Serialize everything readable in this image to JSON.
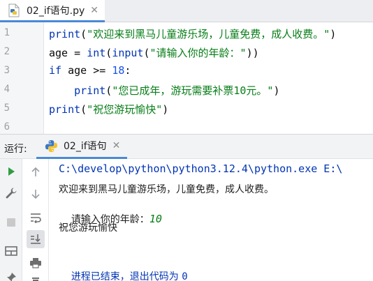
{
  "editor_tab": {
    "title": "02_if语句.py",
    "close": "✕",
    "icon": "python-file-icon"
  },
  "code_lines": [
    {
      "num": "1",
      "parts": [
        {
          "t": "print",
          "c": "kw-fn"
        },
        {
          "t": "(",
          "c": ""
        },
        {
          "t": "\"欢迎来到黑马儿童游乐场，儿童免费，成人收费。\"",
          "c": "str"
        },
        {
          "t": ")",
          "c": ""
        }
      ]
    },
    {
      "num": "2",
      "parts": [
        {
          "t": "age = ",
          "c": ""
        },
        {
          "t": "int",
          "c": "kw-fn"
        },
        {
          "t": "(",
          "c": ""
        },
        {
          "t": "input",
          "c": "kw-fn"
        },
        {
          "t": "(",
          "c": ""
        },
        {
          "t": "\"请输入你的年龄：\"",
          "c": "str"
        },
        {
          "t": "))",
          "c": ""
        }
      ]
    },
    {
      "num": "3",
      "parts": [
        {
          "t": "if",
          "c": "kw-fn"
        },
        {
          "t": " age >= ",
          "c": ""
        },
        {
          "t": "18",
          "c": "num"
        },
        {
          "t": ":",
          "c": ""
        }
      ]
    },
    {
      "num": "4",
      "parts": [
        {
          "t": "    ",
          "c": ""
        },
        {
          "t": "print",
          "c": "kw-fn"
        },
        {
          "t": "(",
          "c": ""
        },
        {
          "t": "\"您已成年，游玩需要补票10元。\"",
          "c": "str"
        },
        {
          "t": ")",
          "c": ""
        }
      ]
    },
    {
      "num": "5",
      "parts": [
        {
          "t": "print",
          "c": "kw-fn"
        },
        {
          "t": "(",
          "c": ""
        },
        {
          "t": "\"祝您游玩愉快\"",
          "c": "str"
        },
        {
          "t": ")",
          "c": ""
        }
      ]
    },
    {
      "num": "6",
      "parts": []
    }
  ],
  "run_panel": {
    "label": "运行:",
    "tab_title": "02_if语句",
    "tab_close": "✕"
  },
  "console": {
    "command": "C:\\develop\\python\\python3.12.4\\python.exe E:\\",
    "output_1": "欢迎来到黑马儿童游乐场，儿童免费，成人收费。",
    "prompt": "请输入你的年龄：",
    "user_input": "10",
    "output_2": "祝您游玩愉快",
    "exit_text": "进程已结束，退出代码为 ",
    "exit_code": "0"
  },
  "colors": {
    "keyword": "#0033b3",
    "string": "#067d17",
    "number": "#1750eb",
    "accent": "#4a88d8",
    "run_green": "#2f9d42"
  }
}
